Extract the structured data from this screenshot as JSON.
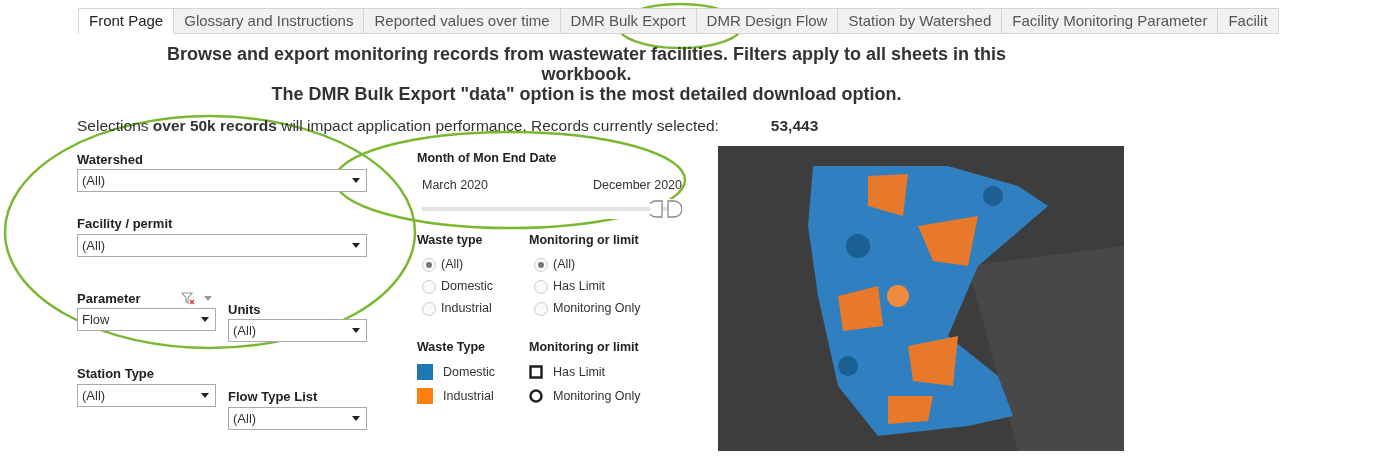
{
  "tabs": [
    {
      "label": "Front Page",
      "selected": true
    },
    {
      "label": "Glossary and Instructions",
      "selected": false
    },
    {
      "label": "Reported values over time",
      "selected": false
    },
    {
      "label": "DMR Bulk Export",
      "selected": false
    },
    {
      "label": "DMR Design Flow",
      "selected": false
    },
    {
      "label": "Station by Watershed",
      "selected": false
    },
    {
      "label": "Facility Monitoring Parameter",
      "selected": false
    },
    {
      "label": "Facilit",
      "selected": false
    }
  ],
  "heading": [
    "Browse and export monitoring records from wastewater facilities.  Filters apply to all sheets in this workbook.",
    "The DMR Bulk Export \"data\" option is the most detailed download option."
  ],
  "notice": {
    "text": "Selections **over 50k records** will impact application performance.  Records currently selected:",
    "record_count": "53,443"
  },
  "filters": [
    {
      "label": "Watershed",
      "value": "(All)",
      "kind": "wide",
      "filter_applied": false
    },
    {
      "label": "Facility / permit",
      "value": "(All)",
      "kind": "wide",
      "filter_applied": false
    },
    {
      "label": "Parameter",
      "value": "Flow",
      "kind": "half",
      "filter_applied": true
    },
    {
      "label": "Units",
      "value": "(All)",
      "kind": "half",
      "filter_applied": false
    },
    {
      "label": "Station Type",
      "value": "(All)",
      "kind": "half",
      "filter_applied": false
    },
    {
      "label": "Flow Type List",
      "value": "(All)",
      "kind": "half",
      "filter_applied": false
    }
  ],
  "date_filter": {
    "label": "Month of Mon End Date",
    "start": "March 2020",
    "end": "December 2020",
    "level": 1
  },
  "radio_groups": [
    {
      "title": "Waste type",
      "options": [
        {
          "label": "(All)",
          "selected": true
        },
        {
          "label": "Domestic",
          "selected": false
        },
        {
          "label": "Industrial",
          "selected": false
        }
      ]
    },
    {
      "title": "Monitoring or limit",
      "options": [
        {
          "label": "(All)",
          "selected": true
        },
        {
          "label": "Has Limit",
          "selected": false
        },
        {
          "label": "Monitoring Only",
          "selected": false
        }
      ]
    }
  ],
  "legends": [
    {
      "title": "Waste Type",
      "items": [
        {
          "label": "Domestic",
          "kind": "swatch",
          "color": "#1f77b4"
        },
        {
          "label": "Industrial",
          "kind": "swatch",
          "color": "#ff7f0e"
        }
      ]
    },
    {
      "title": "Monitoring or limit",
      "items": [
        {
          "label": "Has Limit",
          "kind": "square"
        },
        {
          "label": "Monitoring Only",
          "kind": "circle"
        }
      ]
    }
  ],
  "map": {
    "kind": "picture"
  }
}
